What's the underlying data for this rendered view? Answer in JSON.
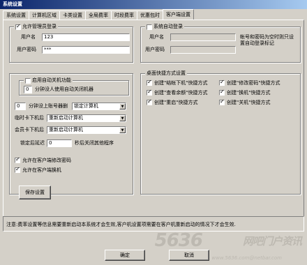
{
  "window": {
    "title": "系统设置"
  },
  "tabs": [
    {
      "label": "系统设置"
    },
    {
      "label": "计算机区域"
    },
    {
      "label": "卡类设置"
    },
    {
      "label": "全局费率"
    },
    {
      "label": "时段费率"
    },
    {
      "label": "优惠包时"
    },
    {
      "label": "客户端设置"
    }
  ],
  "admin_login": {
    "title": "允许管理员登录",
    "user_label": "用户名",
    "user_value": "123",
    "pass_label": "用户密码",
    "pass_value": "***"
  },
  "auto_login": {
    "title": "系统自动登录",
    "user_label": "用户名",
    "pass_label": "用户密码",
    "note": "帐号和密码为空时则只设置自动登录标记"
  },
  "auto_shutdown": {
    "title": "启用自动关机功能",
    "idle_value": "0",
    "idle_label": "分钟没人使用自动关闭机器"
  },
  "settings": {
    "nologin_value": "0",
    "nologin_label": "分钟没上账号器删",
    "nologin_select": "锁定计算机",
    "temp_label": "临时卡下机后",
    "temp_select": "重新启动计算机",
    "member_label": "会员卡下机后",
    "member_select": "重新启动计算机",
    "lock_label": "锁定后延迟",
    "lock_value": "0",
    "lock_suffix": "秒后关闭其他程序",
    "allow_change_pwd": "允许在客户端修改密码",
    "allow_switch": "允许在客户端换机"
  },
  "desktop": {
    "title": "桌面快捷方式设置",
    "items": [
      {
        "label": "创建\"结帐下机\"快捷方式"
      },
      {
        "label": "创建\"修改密码\"快捷方式"
      },
      {
        "label": "创建\"查看余额\"快捷方式"
      },
      {
        "label": "创建\"换机\"快捷方式"
      },
      {
        "label": "创建\"重启\"快捷方式"
      },
      {
        "label": "创建\"关机\"快捷方式"
      }
    ]
  },
  "save_label": "保存设置",
  "note": "注意:费率设置等信息需要重新启动本系统才会生效,客户机设置项需要在客户机重新启动的情况下才会生效.",
  "ok_label": "确定",
  "cancel_label": "取消",
  "watermark": "5636",
  "watermark_text": "网吧门户资讯",
  "watermark_url": "www.5636.com@netbar.com"
}
